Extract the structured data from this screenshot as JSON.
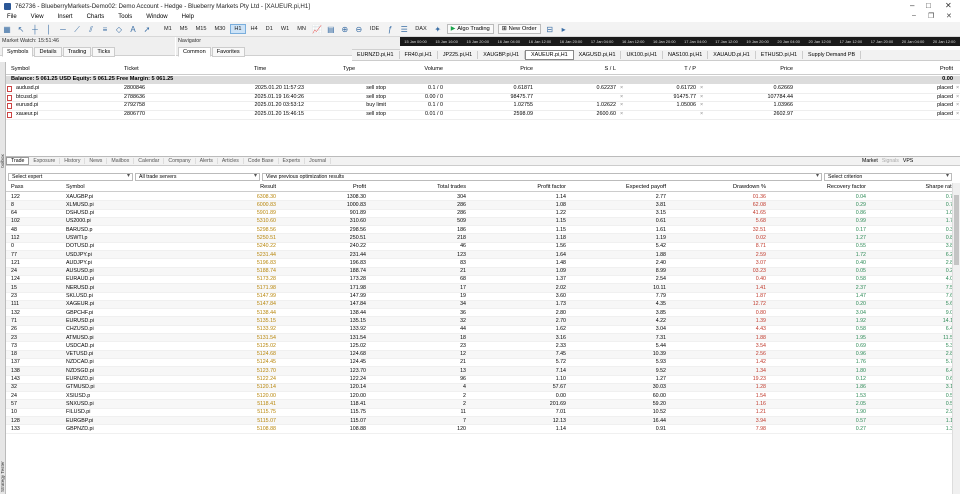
{
  "window": {
    "title": "762736 - BlueberryMarkets-Demo02: Demo Account - Hedge - Blueberry Markets Pty Ltd - [XAUEUR.pi,H1]"
  },
  "menu": [
    "File",
    "View",
    "Insert",
    "Charts",
    "Tools",
    "Window",
    "Help"
  ],
  "toolbar": {
    "timeframes": [
      "M1",
      "M5",
      "M15",
      "M30",
      "H1",
      "H4",
      "D1",
      "W1",
      "MN"
    ],
    "active_tf": "H1",
    "algo": "Algo Trading",
    "neworder": "New Order",
    "zoom_labels": [
      "IDE",
      "DAX"
    ]
  },
  "timescale": [
    "15 Jan 00:00",
    "15 Jan 16:00",
    "15 Jan 20:00",
    "16 Jan 04:00",
    "16 Jan 12:00",
    "16 Jan 20:00",
    "17 Jan 04:00",
    "16 Jan 12:00",
    "16 Jan 20:00",
    "17 Jan 04:00",
    "17 Jan 12:00",
    "19 Jan 20:00",
    "20 Jan 04:00",
    "20 Jan 12:00",
    "17 Jan 12:00",
    "17 Jan 20:00",
    "20 Jan 04:00",
    "20 Jan 12:00"
  ],
  "market_watch": {
    "title": "Market Watch: 15:51:46",
    "tabs": [
      "Symbols",
      "Details",
      "Trading",
      "Ticks"
    ]
  },
  "navigator": {
    "title": "Navigator",
    "tabs": [
      "Common",
      "Favorites"
    ]
  },
  "chart_tabs": [
    "EURNZD.pi,H1",
    "FR40.pi,H1",
    "JP225.pi,H1",
    "XAUGBP.pi,H1",
    "XAUEUR.pi,H1",
    "XAGUSD.pi,H1",
    "UK100.pi,H1",
    "NAS100.pi,H1",
    "XAUAUD.pi,H1",
    "ETHUSD.pi,H1",
    "Supply Demand PB"
  ],
  "active_chart": "XAUEUR.pi,H1",
  "orders": {
    "headers": [
      "Symbol",
      "Ticket",
      "Time",
      "Type",
      "Volume",
      "Price",
      "S / L",
      "T / P",
      "Price",
      "Profit"
    ],
    "balance": "Balance: 5 061.25 USD  Equity: 5 061.25  Free Margin: 5 061.25",
    "balance_profit": "0.00",
    "rows": [
      {
        "symbol": "audusd.pi",
        "ticket": "2800846",
        "time": "2025.01.20 11:57:23",
        "type": "sell stop",
        "volume": "0.1 / 0",
        "price": "0.61871",
        "sl": "0.62237",
        "tp": "0.61720",
        "cur": "0.62669",
        "state": "placed"
      },
      {
        "symbol": "btcusd.pi",
        "ticket": "2788636",
        "time": "2025.01.19 16:40:26",
        "type": "sell stop",
        "volume": "0.00 / 0",
        "price": "98475.77",
        "sl": "",
        "tp": "91475.77",
        "cur": "107784.44",
        "state": "placed"
      },
      {
        "symbol": "eurusd.pi",
        "ticket": "2792758",
        "time": "2025.01.20 03:53:12",
        "type": "buy limit",
        "volume": "0.1 / 0",
        "price": "1.02755",
        "sl": "1.02622",
        "tp": "1.05006",
        "cur": "1.03966",
        "state": "placed"
      },
      {
        "symbol": "xaueur.pi",
        "ticket": "2806770",
        "time": "2025.01.20 15:46:15",
        "type": "sell stop",
        "volume": "0.01 / 0",
        "price": "2598.09",
        "sl": "2600.60",
        "tp": "",
        "cur": "2602.97",
        "state": "placed"
      }
    ]
  },
  "toolbox_label": "Toolbox",
  "tester_label": "Strategy Tester",
  "bottom_tabs": [
    "Trade",
    "Exposure",
    "History",
    "News",
    "Mailbox",
    "Calendar",
    "Company",
    "Alerts",
    "Articles",
    "Code Base",
    "Experts",
    "Journal"
  ],
  "active_bottom_tab": "Trade",
  "right_tools": {
    "market": "Market",
    "signals": "Signals",
    "vps": "VPS"
  },
  "filters": {
    "expert": "Select expert",
    "servers": "All trade servers",
    "view": "View previous optimization results",
    "criterion": "Select criterion"
  },
  "opt": {
    "headers": [
      "Pass",
      "Symbol",
      "Result",
      "Profit",
      "Total trades",
      "Profit factor",
      "Expected payoff",
      "Drawdown %",
      "Recovery factor",
      "Sharpe ratio"
    ],
    "colors": {
      "result": "#b8860b",
      "dd": "#c0392b",
      "rf": "#2e8b57",
      "sharpe": "#2e8b57"
    },
    "rows": [
      [
        "122",
        "XAUGBP.pi",
        "6308.30",
        "1308.30",
        "304",
        "1.14",
        "2.77",
        "01.36",
        "0.04",
        "0.72"
      ],
      [
        "8",
        "XLMUSD.pi",
        "6000.83",
        "1000.83",
        "286",
        "1.08",
        "3.81",
        "62.08",
        "0.29",
        "0.70"
      ],
      [
        "64",
        "DSHUSD.pi",
        "5901.89",
        "901.89",
        "286",
        "1.22",
        "3.15",
        "41.65",
        "0.86",
        "1.01"
      ],
      [
        "102",
        "US2000.pi",
        "5310.60",
        "310.60",
        "509",
        "1.15",
        "0.61",
        "5.68",
        "0.99",
        "1.73"
      ],
      [
        "48",
        "BARUSD.p",
        "5298.56",
        "298.56",
        "186",
        "1.15",
        "1.61",
        "32.51",
        "0.17",
        "0.32"
      ],
      [
        "112",
        "USWTI.p",
        "5250.51",
        "250.51",
        "218",
        "1.18",
        "1.19",
        "0.02",
        "1.27",
        "0.82"
      ],
      [
        "0",
        "DOTUSD.pi",
        "5240.22",
        "240.22",
        "46",
        "1.56",
        "5.42",
        "8.71",
        "0.55",
        "3.87"
      ],
      [
        "77",
        "USDJPY.pi",
        "5231.44",
        "231.44",
        "123",
        "1.64",
        "1.88",
        "2.59",
        "1.72",
        "6.27"
      ],
      [
        "121",
        "AUDJPY.pi",
        "5196.83",
        "196.83",
        "83",
        "1.48",
        "2.40",
        "3.07",
        "0.40",
        "2.88"
      ],
      [
        "24",
        "AUSUSD.pi",
        "5188.74",
        "188.74",
        "21",
        "1.09",
        "8.99",
        "03.23",
        "0.05",
        "0.20"
      ],
      [
        "124",
        "EURAUD.pi",
        "5173.28",
        "173.28",
        "68",
        "1.37",
        "2.54",
        "0.40",
        "0.58",
        "4.02"
      ],
      [
        "15",
        "NERUSD.pi",
        "5171.98",
        "171.98",
        "17",
        "2.02",
        "10.11",
        "1.41",
        "2.37",
        "7.54"
      ],
      [
        "23",
        "SKLUSD.pi",
        "5147.99",
        "147.99",
        "19",
        "3.60",
        "7.79",
        "1.87",
        "1.47",
        "7.62"
      ],
      [
        "111",
        "XAGEUR.pi",
        "5147.84",
        "147.84",
        "34",
        "1.73",
        "4.35",
        "12.72",
        "0.20",
        "5.64"
      ],
      [
        "132",
        "GBPCHF.pi",
        "5138.44",
        "138.44",
        "36",
        "2.80",
        "3.85",
        "0.80",
        "3.04",
        "9.00"
      ],
      [
        "71",
        "EURUSD.pi",
        "5135.15",
        "135.15",
        "32",
        "2.70",
        "4.22",
        "1.39",
        "1.92",
        "14.12"
      ],
      [
        "26",
        "CHZUSD.pi",
        "5133.92",
        "133.92",
        "44",
        "1.62",
        "3.04",
        "4.43",
        "0.58",
        "6.44"
      ],
      [
        "23",
        "ATMUSD.pi",
        "5131.54",
        "131.54",
        "18",
        "3.16",
        "7.31",
        "1.88",
        "1.95",
        "11.57"
      ],
      [
        "73",
        "USDCAD.pi",
        "5125.02",
        "125.02",
        "23",
        "2.33",
        "5.44",
        "3.54",
        "0.69",
        "5.37"
      ],
      [
        "18",
        "VETUSD.pi",
        "5124.68",
        "124.68",
        "12",
        "7.45",
        "10.39",
        "2.56",
        "0.96",
        "2.87"
      ],
      [
        "137",
        "NZDCAD.pi",
        "5124.45",
        "124.45",
        "21",
        "5.72",
        "5.93",
        "1.42",
        "1.76",
        "5.70"
      ],
      [
        "138",
        "NZDSGD.pi",
        "5123.70",
        "123.70",
        "13",
        "7.14",
        "9.52",
        "1.34",
        "1.80",
        "6.44"
      ],
      [
        "143",
        "EURNZD.pi",
        "5122.24",
        "122.24",
        "96",
        "1.10",
        "1.27",
        "19.23",
        "0.12",
        "0.69"
      ],
      [
        "32",
        "GTMUSD.pi",
        "5120.14",
        "120.14",
        "4",
        "57.67",
        "30.03",
        "1.28",
        "1.86",
        "3.14"
      ],
      [
        "24",
        "XSIUSD.p",
        "5120.00",
        "120.00",
        "2",
        "0.00",
        "60.00",
        "1.54",
        "1.53",
        "0.50"
      ],
      [
        "57",
        "SNXUSD.pi",
        "5118.41",
        "118.41",
        "2",
        "201.69",
        "59.20",
        "1.16",
        "2.05",
        "0.58"
      ],
      [
        "10",
        "FILUSD.pi",
        "5115.75",
        "115.75",
        "11",
        "7.01",
        "10.52",
        "1.21",
        "1.90",
        "2.90"
      ],
      [
        "128",
        "EURGBP.pi",
        "5115.07",
        "115.07",
        "7",
        "12.13",
        "16.44",
        "3.94",
        "0.57",
        "1.19"
      ],
      [
        "133",
        "GBPNZD.pi",
        "5108.88",
        "108.88",
        "120",
        "1.14",
        "0.91",
        "7.98",
        "0.27",
        "1.38"
      ]
    ]
  }
}
